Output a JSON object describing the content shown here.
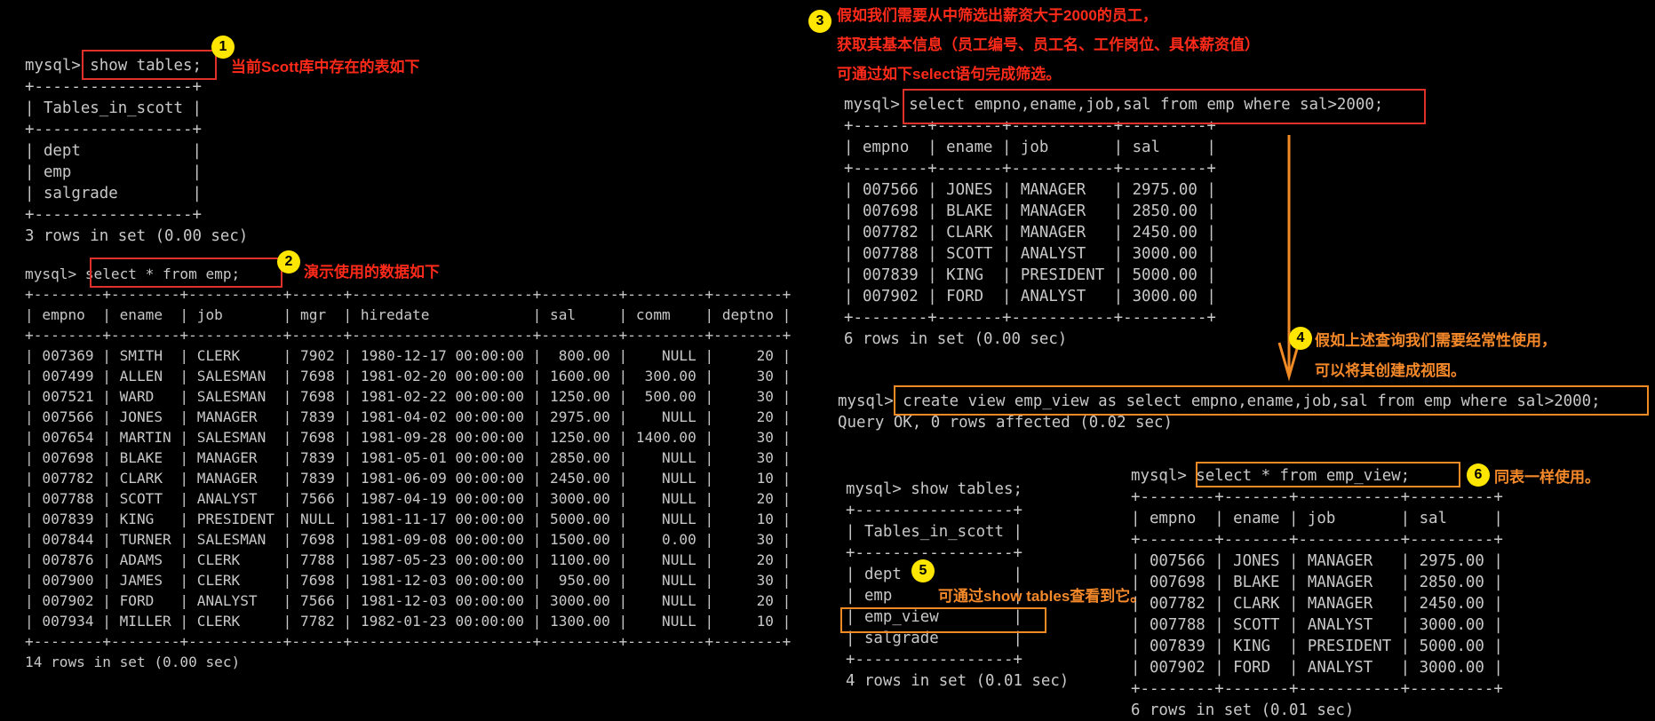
{
  "blocks": {
    "show_tables": "mysql> show tables;\n+-----------------+\n| Tables_in_scott |\n+-----------------+\n| dept            |\n| emp             |\n| salgrade        |\n+-----------------+\n3 rows in set (0.00 sec)",
    "select_emp": "mysql> select * from emp;\n+--------+--------+-----------+------+---------------------+---------+---------+--------+\n| empno  | ename  | job       | mgr  | hiredate            | sal     | comm    | deptno |\n+--------+--------+-----------+------+---------------------+---------+---------+--------+\n| 007369 | SMITH  | CLERK     | 7902 | 1980-12-17 00:00:00 |  800.00 |    NULL |     20 |\n| 007499 | ALLEN  | SALESMAN  | 7698 | 1981-02-20 00:00:00 | 1600.00 |  300.00 |     30 |\n| 007521 | WARD   | SALESMAN  | 7698 | 1981-02-22 00:00:00 | 1250.00 |  500.00 |     30 |\n| 007566 | JONES  | MANAGER   | 7839 | 1981-04-02 00:00:00 | 2975.00 |    NULL |     20 |\n| 007654 | MARTIN | SALESMAN  | 7698 | 1981-09-28 00:00:00 | 1250.00 | 1400.00 |     30 |\n| 007698 | BLAKE  | MANAGER   | 7839 | 1981-05-01 00:00:00 | 2850.00 |    NULL |     30 |\n| 007782 | CLARK  | MANAGER   | 7839 | 1981-06-09 00:00:00 | 2450.00 |    NULL |     10 |\n| 007788 | SCOTT  | ANALYST   | 7566 | 1987-04-19 00:00:00 | 3000.00 |    NULL |     20 |\n| 007839 | KING   | PRESIDENT | NULL | 1981-11-17 00:00:00 | 5000.00 |    NULL |     10 |\n| 007844 | TURNER | SALESMAN  | 7698 | 1981-09-08 00:00:00 | 1500.00 |    0.00 |     30 |\n| 007876 | ADAMS  | CLERK     | 7788 | 1987-05-23 00:00:00 | 1100.00 |    NULL |     20 |\n| 007900 | JAMES  | CLERK     | 7698 | 1981-12-03 00:00:00 |  950.00 |    NULL |     30 |\n| 007902 | FORD   | ANALYST   | 7566 | 1981-12-03 00:00:00 | 3000.00 |    NULL |     20 |\n| 007934 | MILLER | CLERK     | 7782 | 1982-01-23 00:00:00 | 1300.00 |    NULL |     10 |\n+--------+--------+-----------+------+---------------------+---------+---------+--------+\n14 rows in set (0.00 sec)",
    "select_sal": "mysql> select empno,ename,job,sal from emp where sal>2000;\n+--------+-------+-----------+---------+\n| empno  | ename | job       | sal     |\n+--------+-------+-----------+---------+\n| 007566 | JONES | MANAGER   | 2975.00 |\n| 007698 | BLAKE | MANAGER   | 2850.00 |\n| 007782 | CLARK | MANAGER   | 2450.00 |\n| 007788 | SCOTT | ANALYST   | 3000.00 |\n| 007839 | KING  | PRESIDENT | 5000.00 |\n| 007902 | FORD  | ANALYST   | 3000.00 |\n+--------+-------+-----------+---------+\n6 rows in set (0.00 sec)",
    "create_view": "mysql> create view emp_view as select empno,ename,job,sal from emp where sal>2000;\nQuery OK, 0 rows affected (0.02 sec)",
    "show_tables_2": "mysql> show tables;\n+-----------------+\n| Tables_in_scott |\n+-----------------+\n| dept            |\n| emp             |\n| emp_view        |\n| salgrade        |\n+-----------------+\n4 rows in set (0.01 sec)",
    "select_view": "mysql> select * from emp_view;\n+--------+-------+-----------+---------+\n| empno  | ename | job       | sal     |\n+--------+-------+-----------+---------+\n| 007566 | JONES | MANAGER   | 2975.00 |\n| 007698 | BLAKE | MANAGER   | 2850.00 |\n| 007782 | CLARK | MANAGER   | 2450.00 |\n| 007788 | SCOTT | ANALYST   | 3000.00 |\n| 007839 | KING  | PRESIDENT | 5000.00 |\n| 007902 | FORD  | ANALYST   | 3000.00 |\n+--------+-------+-----------+---------+\n6 rows in set (0.01 sec)"
  },
  "badges": [
    "1",
    "2",
    "3",
    "4",
    "5",
    "6"
  ],
  "notes": {
    "n1": "当前Scott库中存在的表如下",
    "n2": "演示使用的数据如下",
    "n3_line1": "假如我们需要从中筛选出薪资大于2000的员工，",
    "n3_line2": "获取其基本信息（员工编号、员工名、工作岗位、具体薪资值）",
    "n3_line3": "可通过如下select语句完成筛选。",
    "n4_line1": "假如上述查询我们需要经常性使用，",
    "n4_line2": "可以将其创建成视图。",
    "n5": "可通过show tables查看到它。",
    "n6": "同表一样使用。"
  },
  "colors": {
    "background": "#000000",
    "terminal_text": "#c8c8c8",
    "red_annotation": "#e0302a",
    "orange_annotation": "#f08a24",
    "badge": "#ffe600"
  }
}
